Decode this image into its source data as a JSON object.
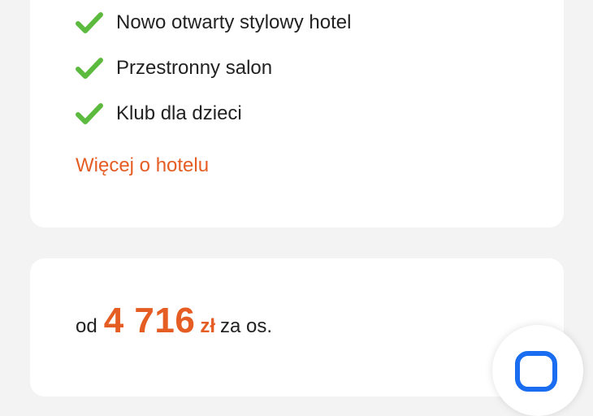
{
  "hotel_features": {
    "items": [
      {
        "label": "Nowo otwarty stylowy hotel",
        "icon": "check-icon"
      },
      {
        "label": "Przestronny salon",
        "icon": "check-icon"
      },
      {
        "label": "Klub dla dzieci",
        "icon": "check-icon"
      }
    ],
    "more_link": "Więcej o hotelu"
  },
  "price": {
    "prefix": "od",
    "amount": "4 716",
    "currency": "zł",
    "suffix": "za os."
  },
  "chat_button": {
    "icon": "chat-icon"
  },
  "colors": {
    "accent": "#e55d22",
    "check": "#5cbb3f",
    "chat": "#1a6df0",
    "background": "#f3f3f3",
    "card": "#ffffff"
  }
}
